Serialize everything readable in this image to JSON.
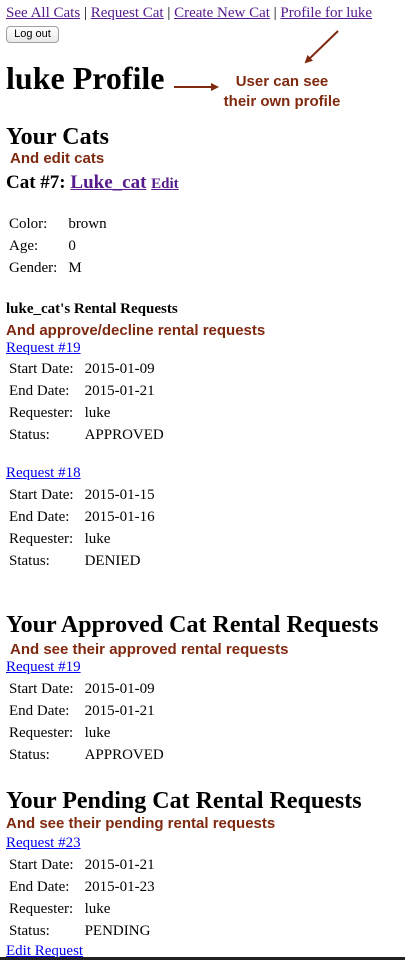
{
  "nav": {
    "links": [
      "See All Cats",
      "Request Cat",
      "Create New Cat",
      "Profile for luke"
    ],
    "separator": "|"
  },
  "logout_label": "Log out",
  "page_title": "luke Profile",
  "annotations": {
    "own_profile": [
      "User can see",
      "their own profile"
    ],
    "edit_cats": "And edit cats",
    "approve_decline": "And approve/decline rental requests",
    "approved": "And see their approved rental requests",
    "pending": "And see their pending rental requests"
  },
  "colors": {
    "annotation": "#7f2a10",
    "link_visited": "#551a8b",
    "link": "#0000ee"
  },
  "your_cats": {
    "heading": "Your Cats",
    "cat_title": "Cat #7:",
    "cat_name": "Luke_cat",
    "edit_label": "Edit",
    "details": [
      {
        "label": "Color:",
        "value": "brown"
      },
      {
        "label": "Age:",
        "value": "0"
      },
      {
        "label": "Gender:",
        "value": "M"
      }
    ]
  },
  "rental_requests": {
    "heading": "luke_cat's Rental Requests",
    "items": [
      {
        "link": "Request #19",
        "rows": [
          {
            "label": "Start Date:",
            "value": "2015-01-09"
          },
          {
            "label": "End Date:",
            "value": "2015-01-21"
          },
          {
            "label": "Requester:",
            "value": "luke"
          },
          {
            "label": "Status:",
            "value": "APPROVED"
          }
        ]
      },
      {
        "link": "Request #18",
        "rows": [
          {
            "label": "Start Date:",
            "value": "2015-01-15"
          },
          {
            "label": "End Date:",
            "value": "2015-01-16"
          },
          {
            "label": "Requester:",
            "value": "luke"
          },
          {
            "label": "Status:",
            "value": "DENIED"
          }
        ]
      }
    ]
  },
  "approved": {
    "heading": "Your Approved Cat Rental Requests",
    "link": "Request #19",
    "rows": [
      {
        "label": "Start Date:",
        "value": "2015-01-09"
      },
      {
        "label": "End Date:",
        "value": "2015-01-21"
      },
      {
        "label": "Requester:",
        "value": "luke"
      },
      {
        "label": "Status:",
        "value": "APPROVED"
      }
    ]
  },
  "pending": {
    "heading": "Your Pending Cat Rental Requests",
    "link": "Request #23",
    "rows": [
      {
        "label": "Start Date:",
        "value": "2015-01-21"
      },
      {
        "label": "End Date:",
        "value": "2015-01-23"
      },
      {
        "label": "Requester:",
        "value": "luke"
      },
      {
        "label": "Status:",
        "value": "PENDING"
      }
    ],
    "edit_link": "Edit Request"
  }
}
